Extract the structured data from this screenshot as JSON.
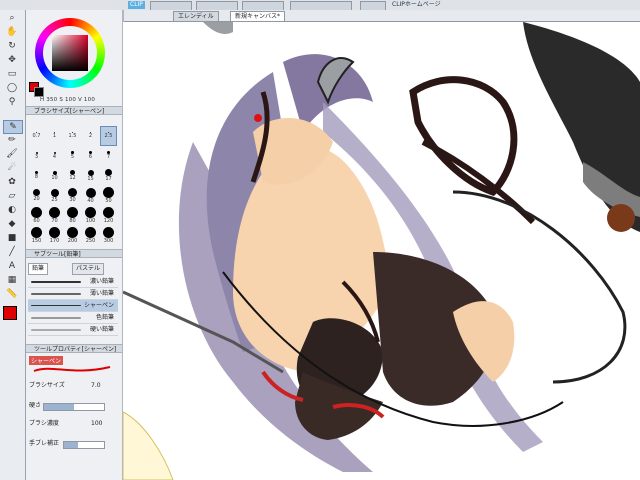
{
  "toolbar": {
    "clip_btn": "CLIP",
    "right_label": "CLIPホームページ"
  },
  "tabs": [
    {
      "label": "エレンディル"
    },
    {
      "label": "新規キャンバス*",
      "active": true
    }
  ],
  "color": {
    "main": "#e00000",
    "sub": "#000000",
    "hsv_text": "H 350  S 100  V 100"
  },
  "brush_panel": {
    "title": "ブラシサイズ[シャーペン]",
    "sizes": [
      [
        "0.7",
        "1",
        "1.5",
        "2",
        "2.5"
      ],
      [
        "3",
        "4",
        "5",
        "6",
        "7"
      ],
      [
        "8",
        "10",
        "12",
        "15",
        "17"
      ],
      [
        "20",
        "25",
        "30",
        "40",
        "50"
      ],
      [
        "60",
        "70",
        "80",
        "100",
        "120"
      ],
      [
        "150",
        "170",
        "200",
        "250",
        "300"
      ]
    ]
  },
  "subtool": {
    "title": "サブツール[鉛筆]",
    "tabs": [
      "鉛筆",
      "パステル"
    ],
    "items": [
      "濃い鉛筆",
      "薄い鉛筆",
      "シャーペン",
      "色鉛筆",
      "硬い鉛筆"
    ]
  },
  "tool_property": {
    "title": "ツールプロパティ[シャーペン]",
    "name": "シャーペン",
    "rows": [
      {
        "label": "ブラシサイズ",
        "value": "7.0"
      },
      {
        "label": "硬さ",
        "value": ""
      },
      {
        "label": "ブラシ濃度",
        "value": "100"
      },
      {
        "label": "手ブレ補正",
        "value": ""
      }
    ]
  },
  "tools": [
    "zoom",
    "hand",
    "rotate",
    "move",
    "select",
    "lasso",
    "eyedropper",
    "pen",
    "pencil",
    "brush",
    "airbrush",
    "decoration",
    "eraser",
    "blend",
    "fill",
    "gradation",
    "figure",
    "text",
    "frame",
    "ruler"
  ]
}
